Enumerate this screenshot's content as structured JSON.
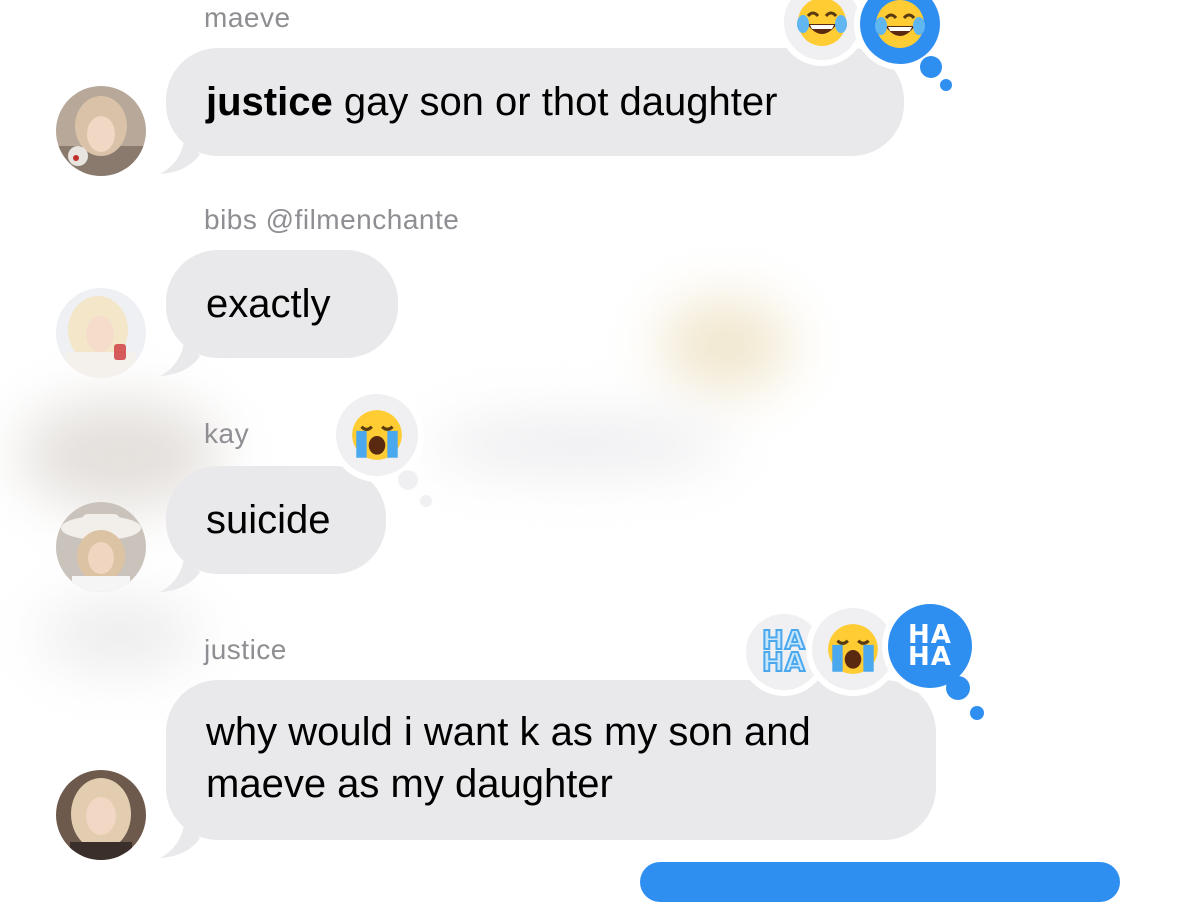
{
  "messages": [
    {
      "sender": "maeve",
      "text_bold": "justice",
      "text": " gay son or thot daughter"
    },
    {
      "sender": "bibs @filmenchante",
      "text": "exactly"
    },
    {
      "sender": "kay",
      "text": "suicide"
    },
    {
      "sender": "justice",
      "text_line1": "why would i want k as my son and",
      "text_line2": "maeve as my daughter"
    }
  ],
  "reactions": {
    "msg1": [
      "joy-emoji",
      "joy-emoji-selected"
    ],
    "msg3": [
      "crying-emoji"
    ],
    "msg4": [
      "haha-sticker",
      "crying-emoji",
      "haha-sticker-selected"
    ],
    "haha_line1": "HA",
    "haha_line2": "HA"
  },
  "colors": {
    "incoming_bubble": "#e9e9eb",
    "reaction_selected": "#2f8ff0",
    "sender_name": "#8e8e93"
  }
}
